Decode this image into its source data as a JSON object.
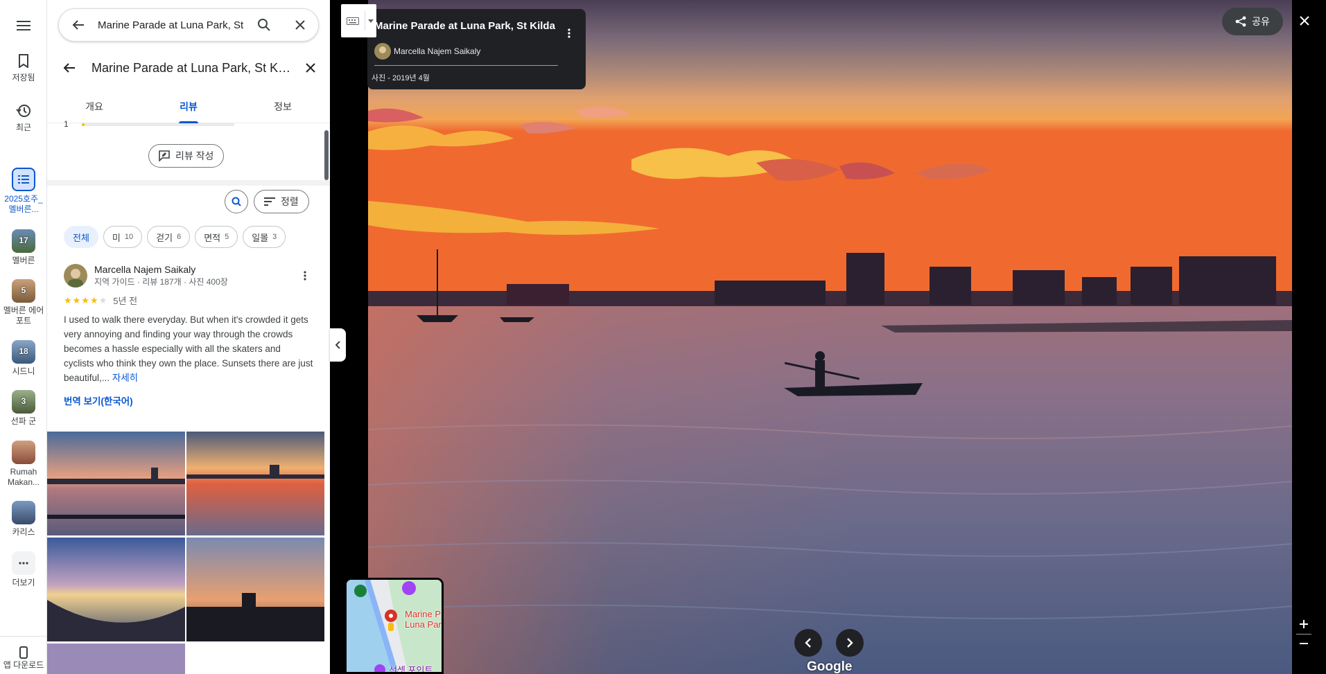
{
  "rail": {
    "menu_icon": "hamburger-icon",
    "items": [
      {
        "label": "저장됨",
        "icon": "bookmark-icon"
      },
      {
        "label": "최근",
        "icon": "history-icon"
      },
      {
        "label": "2025호주_멜버른...",
        "icon": "list-icon"
      },
      {
        "label": "멜버른",
        "badge": "17"
      },
      {
        "label": "멜버른 에어포트",
        "badge": "5"
      },
      {
        "label": "시드니",
        "badge": "18"
      },
      {
        "label": "선파 군",
        "badge": "3"
      },
      {
        "label": "Rumah Makan...",
        "badge": ""
      },
      {
        "label": "카리스",
        "badge": ""
      },
      {
        "label": "더보기",
        "icon": "more-icon"
      }
    ],
    "app_download": "앱 다운로드"
  },
  "search": {
    "value": "Marine Parade at Luna Park, St Kilda"
  },
  "place": {
    "title": "Marine Parade at Luna Park, St Kilda"
  },
  "tabs": [
    "개요",
    "리뷰",
    "정보"
  ],
  "rating_fragment": "1",
  "write_review_label": "리뷰 작성",
  "sort_label": "정렬",
  "chips": [
    {
      "label": "전체",
      "count": ""
    },
    {
      "label": "미",
      "count": "10"
    },
    {
      "label": "걷기",
      "count": "6"
    },
    {
      "label": "면적",
      "count": "5"
    },
    {
      "label": "일몰",
      "count": "3"
    }
  ],
  "review": {
    "author": "Marcella Najem Saikaly",
    "meta": "지역 가이드 · 리뷰 187개 · 사진 400장",
    "rating": 4,
    "stars_on": "★★★★",
    "stars_off": "★",
    "time": "5년 전",
    "text": "I used to walk there everyday. But when it's crowded it gets very annoying and finding your way through the crowds becomes a hassle especially with all the skaters and cyclists who think they own the place. Sunsets there are just beautiful,...",
    "more_label": "자세히",
    "translate_label": "번역 보기(한국어)"
  },
  "viewer": {
    "title": "Marine Parade at Luna Park, St Kilda",
    "author": "Marcella Najem Saikaly",
    "date": "사진 - 2019년 4월",
    "share_label": "공유",
    "logo": "Google",
    "minimap_label_1": "Marine P",
    "minimap_label_2": "Luna Par",
    "minimap_label_3": "선셋 포인트"
  },
  "colors": {
    "accent": "#0b57d0",
    "star": "#fbbc04",
    "card_bg": "#202124"
  }
}
